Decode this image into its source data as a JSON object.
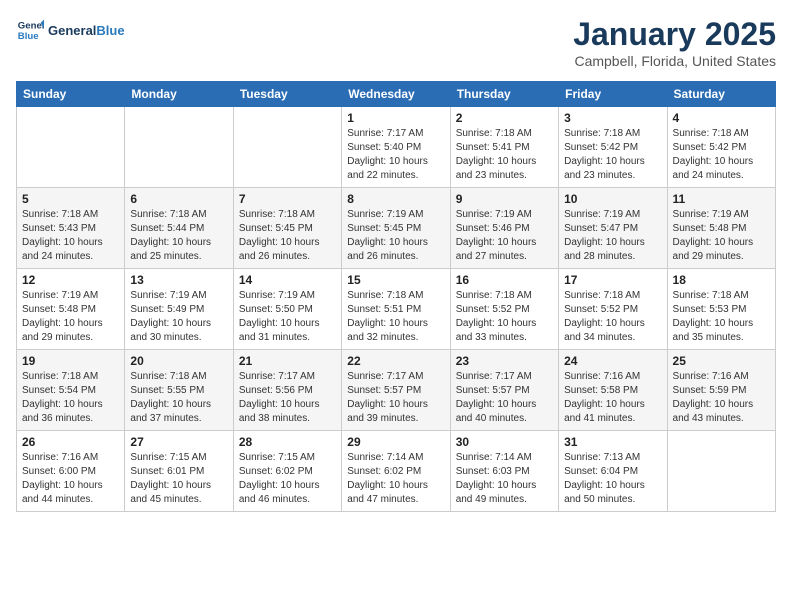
{
  "logo": {
    "line1": "General",
    "line2": "Blue"
  },
  "title": "January 2025",
  "location": "Campbell, Florida, United States",
  "weekdays": [
    "Sunday",
    "Monday",
    "Tuesday",
    "Wednesday",
    "Thursday",
    "Friday",
    "Saturday"
  ],
  "weeks": [
    [
      {
        "day": "",
        "info": ""
      },
      {
        "day": "",
        "info": ""
      },
      {
        "day": "",
        "info": ""
      },
      {
        "day": "1",
        "info": "Sunrise: 7:17 AM\nSunset: 5:40 PM\nDaylight: 10 hours\nand 22 minutes."
      },
      {
        "day": "2",
        "info": "Sunrise: 7:18 AM\nSunset: 5:41 PM\nDaylight: 10 hours\nand 23 minutes."
      },
      {
        "day": "3",
        "info": "Sunrise: 7:18 AM\nSunset: 5:42 PM\nDaylight: 10 hours\nand 23 minutes."
      },
      {
        "day": "4",
        "info": "Sunrise: 7:18 AM\nSunset: 5:42 PM\nDaylight: 10 hours\nand 24 minutes."
      }
    ],
    [
      {
        "day": "5",
        "info": "Sunrise: 7:18 AM\nSunset: 5:43 PM\nDaylight: 10 hours\nand 24 minutes."
      },
      {
        "day": "6",
        "info": "Sunrise: 7:18 AM\nSunset: 5:44 PM\nDaylight: 10 hours\nand 25 minutes."
      },
      {
        "day": "7",
        "info": "Sunrise: 7:18 AM\nSunset: 5:45 PM\nDaylight: 10 hours\nand 26 minutes."
      },
      {
        "day": "8",
        "info": "Sunrise: 7:19 AM\nSunset: 5:45 PM\nDaylight: 10 hours\nand 26 minutes."
      },
      {
        "day": "9",
        "info": "Sunrise: 7:19 AM\nSunset: 5:46 PM\nDaylight: 10 hours\nand 27 minutes."
      },
      {
        "day": "10",
        "info": "Sunrise: 7:19 AM\nSunset: 5:47 PM\nDaylight: 10 hours\nand 28 minutes."
      },
      {
        "day": "11",
        "info": "Sunrise: 7:19 AM\nSunset: 5:48 PM\nDaylight: 10 hours\nand 29 minutes."
      }
    ],
    [
      {
        "day": "12",
        "info": "Sunrise: 7:19 AM\nSunset: 5:48 PM\nDaylight: 10 hours\nand 29 minutes."
      },
      {
        "day": "13",
        "info": "Sunrise: 7:19 AM\nSunset: 5:49 PM\nDaylight: 10 hours\nand 30 minutes."
      },
      {
        "day": "14",
        "info": "Sunrise: 7:19 AM\nSunset: 5:50 PM\nDaylight: 10 hours\nand 31 minutes."
      },
      {
        "day": "15",
        "info": "Sunrise: 7:18 AM\nSunset: 5:51 PM\nDaylight: 10 hours\nand 32 minutes."
      },
      {
        "day": "16",
        "info": "Sunrise: 7:18 AM\nSunset: 5:52 PM\nDaylight: 10 hours\nand 33 minutes."
      },
      {
        "day": "17",
        "info": "Sunrise: 7:18 AM\nSunset: 5:52 PM\nDaylight: 10 hours\nand 34 minutes."
      },
      {
        "day": "18",
        "info": "Sunrise: 7:18 AM\nSunset: 5:53 PM\nDaylight: 10 hours\nand 35 minutes."
      }
    ],
    [
      {
        "day": "19",
        "info": "Sunrise: 7:18 AM\nSunset: 5:54 PM\nDaylight: 10 hours\nand 36 minutes."
      },
      {
        "day": "20",
        "info": "Sunrise: 7:18 AM\nSunset: 5:55 PM\nDaylight: 10 hours\nand 37 minutes."
      },
      {
        "day": "21",
        "info": "Sunrise: 7:17 AM\nSunset: 5:56 PM\nDaylight: 10 hours\nand 38 minutes."
      },
      {
        "day": "22",
        "info": "Sunrise: 7:17 AM\nSunset: 5:57 PM\nDaylight: 10 hours\nand 39 minutes."
      },
      {
        "day": "23",
        "info": "Sunrise: 7:17 AM\nSunset: 5:57 PM\nDaylight: 10 hours\nand 40 minutes."
      },
      {
        "day": "24",
        "info": "Sunrise: 7:16 AM\nSunset: 5:58 PM\nDaylight: 10 hours\nand 41 minutes."
      },
      {
        "day": "25",
        "info": "Sunrise: 7:16 AM\nSunset: 5:59 PM\nDaylight: 10 hours\nand 43 minutes."
      }
    ],
    [
      {
        "day": "26",
        "info": "Sunrise: 7:16 AM\nSunset: 6:00 PM\nDaylight: 10 hours\nand 44 minutes."
      },
      {
        "day": "27",
        "info": "Sunrise: 7:15 AM\nSunset: 6:01 PM\nDaylight: 10 hours\nand 45 minutes."
      },
      {
        "day": "28",
        "info": "Sunrise: 7:15 AM\nSunset: 6:02 PM\nDaylight: 10 hours\nand 46 minutes."
      },
      {
        "day": "29",
        "info": "Sunrise: 7:14 AM\nSunset: 6:02 PM\nDaylight: 10 hours\nand 47 minutes."
      },
      {
        "day": "30",
        "info": "Sunrise: 7:14 AM\nSunset: 6:03 PM\nDaylight: 10 hours\nand 49 minutes."
      },
      {
        "day": "31",
        "info": "Sunrise: 7:13 AM\nSunset: 6:04 PM\nDaylight: 10 hours\nand 50 minutes."
      },
      {
        "day": "",
        "info": ""
      }
    ]
  ]
}
